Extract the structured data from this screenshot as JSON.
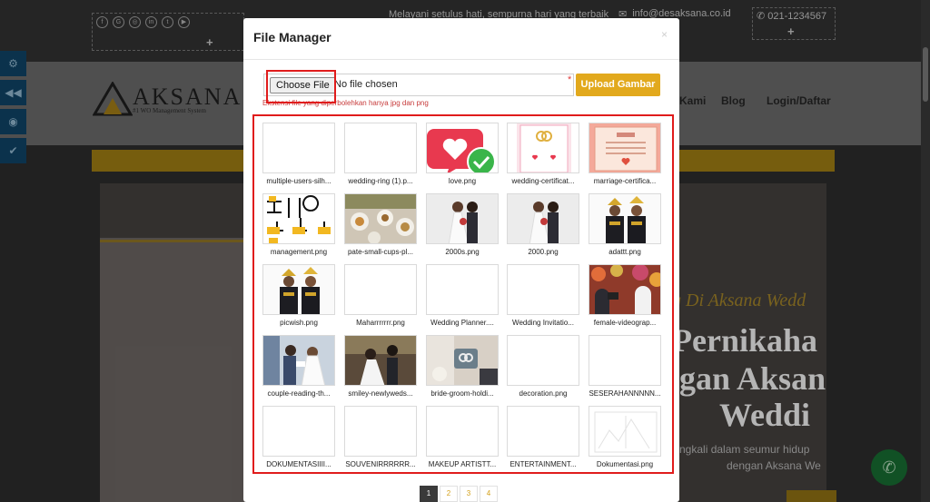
{
  "site": {
    "topbar_text": "Melayani setulus hati, sempurna hari yang terbaik",
    "email": "info@desaksana.co.id",
    "phone": "021-1234567",
    "logo_name": "AKSANA",
    "logo_tagline": "#1 WO Management System",
    "nav": {
      "item_partial": "Kami",
      "blog": "Blog",
      "login": "Login/Daftar"
    },
    "hero_script": "g Di Aksana Wedd",
    "hero_line1": "Pernikaha",
    "hero_line2": "gan Aksan",
    "hero_line3": "Weddi",
    "hero_sub1": "ngkali dalam seumur hidup",
    "hero_sub2": "dengan Aksana We"
  },
  "modal": {
    "title": "File Manager",
    "close": "×",
    "choose_file_label": "Choose File",
    "no_file_text": "No file chosen",
    "required_mark": "*",
    "upload_label": "Upload Gambar",
    "help_text": "Ekstensi file yang diperbolehkan hanya jpg dan png"
  },
  "files": [
    {
      "name": "multiple-users-silh...",
      "thumb": "blank"
    },
    {
      "name": "wedding-ring (1).p...",
      "thumb": "blank"
    },
    {
      "name": "love.png",
      "thumb": "love"
    },
    {
      "name": "wedding-certificat...",
      "thumb": "certificate-pink"
    },
    {
      "name": "marriage-certifica...",
      "thumb": "certificate-peach"
    },
    {
      "name": "management.png",
      "thumb": "management"
    },
    {
      "name": "pate-small-cups-pl...",
      "thumb": "food"
    },
    {
      "name": "2000s.png",
      "thumb": "couple-white"
    },
    {
      "name": "2000.png",
      "thumb": "couple-white"
    },
    {
      "name": "adattt.png",
      "thumb": "couple-traditional"
    },
    {
      "name": "picwish.png",
      "thumb": "couple-traditional"
    },
    {
      "name": "Maharrrrrrr.png",
      "thumb": "blank"
    },
    {
      "name": "Wedding Planner....",
      "thumb": "blank"
    },
    {
      "name": "Wedding Invitatio...",
      "thumb": "blank"
    },
    {
      "name": "female-videograp...",
      "thumb": "videographer"
    },
    {
      "name": "couple-reading-th...",
      "thumb": "reading"
    },
    {
      "name": "smiley-newlyweds...",
      "thumb": "newlyweds"
    },
    {
      "name": "bride-groom-holdi...",
      "thumb": "rings-box"
    },
    {
      "name": "decoration.png",
      "thumb": "blank"
    },
    {
      "name": "SESERAHANNNNN...",
      "thumb": "blank"
    },
    {
      "name": "DOKUMENTASIIII...",
      "thumb": "blank"
    },
    {
      "name": "SOUVENIRRRRRR...",
      "thumb": "blank"
    },
    {
      "name": "MAKEUP ARTISTT...",
      "thumb": "blank"
    },
    {
      "name": "ENTERTAINMENT...",
      "thumb": "blank"
    },
    {
      "name": "Dokumentasi.png",
      "thumb": "doc-sketch"
    }
  ],
  "pagination": {
    "pages": [
      "1",
      "2",
      "3",
      "4"
    ],
    "active": "1"
  }
}
